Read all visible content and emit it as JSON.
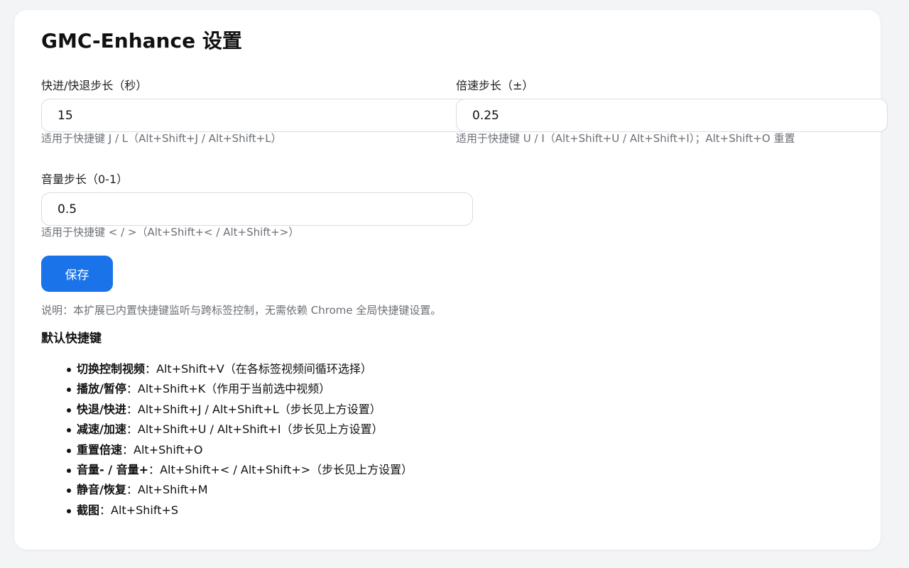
{
  "title": "GMC-Enhance 设置",
  "fields": {
    "seek": {
      "label": "快进/快退步长（秒）",
      "value": "15",
      "hint": "适用于快捷键 J / L（Alt+Shift+J / Alt+Shift+L）"
    },
    "speed": {
      "label": "倍速步长（±）",
      "value": "0.25",
      "hint": "适用于快捷键 U / I（Alt+Shift+U / Alt+Shift+I）；Alt+Shift+O 重置"
    },
    "volume": {
      "label": "音量步长（0-1）",
      "value": "0.5",
      "hint": "适用于快捷键 < / >（Alt+Shift+< / Alt+Shift+>）"
    }
  },
  "save_label": "保存",
  "note": "说明：本扩展已内置快捷键监听与跨标签控制，无需依赖 Chrome 全局快捷键设置。",
  "shortcuts_title": "默认快捷键",
  "shortcuts": [
    {
      "name": "切换控制视频",
      "sep": "：",
      "desc": "Alt+Shift+V（在各标签视频间循环选择）"
    },
    {
      "name": "播放/暂停",
      "sep": "：",
      "desc": "Alt+Shift+K（作用于当前选中视频）"
    },
    {
      "name": "快退/快进",
      "sep": "：",
      "desc": "Alt+Shift+J / Alt+Shift+L（步长见上方设置）"
    },
    {
      "name": "减速/加速",
      "sep": "：",
      "desc": "Alt+Shift+U / Alt+Shift+I（步长见上方设置）"
    },
    {
      "name": "重置倍速",
      "sep": "：",
      "desc": "Alt+Shift+O"
    },
    {
      "name": "音量- / 音量+",
      "sep": "：",
      "desc": "Alt+Shift+< / Alt+Shift+>（步长见上方设置）"
    },
    {
      "name": "静音/恢复",
      "sep": "：",
      "desc": "Alt+Shift+M"
    },
    {
      "name": "截图",
      "sep": "：",
      "desc": "Alt+Shift+S"
    }
  ],
  "colors": {
    "accent": "#1a73e8",
    "hint_text": "#6b6f76",
    "input_border": "#d7dce3",
    "background": "#f3f4f6"
  }
}
